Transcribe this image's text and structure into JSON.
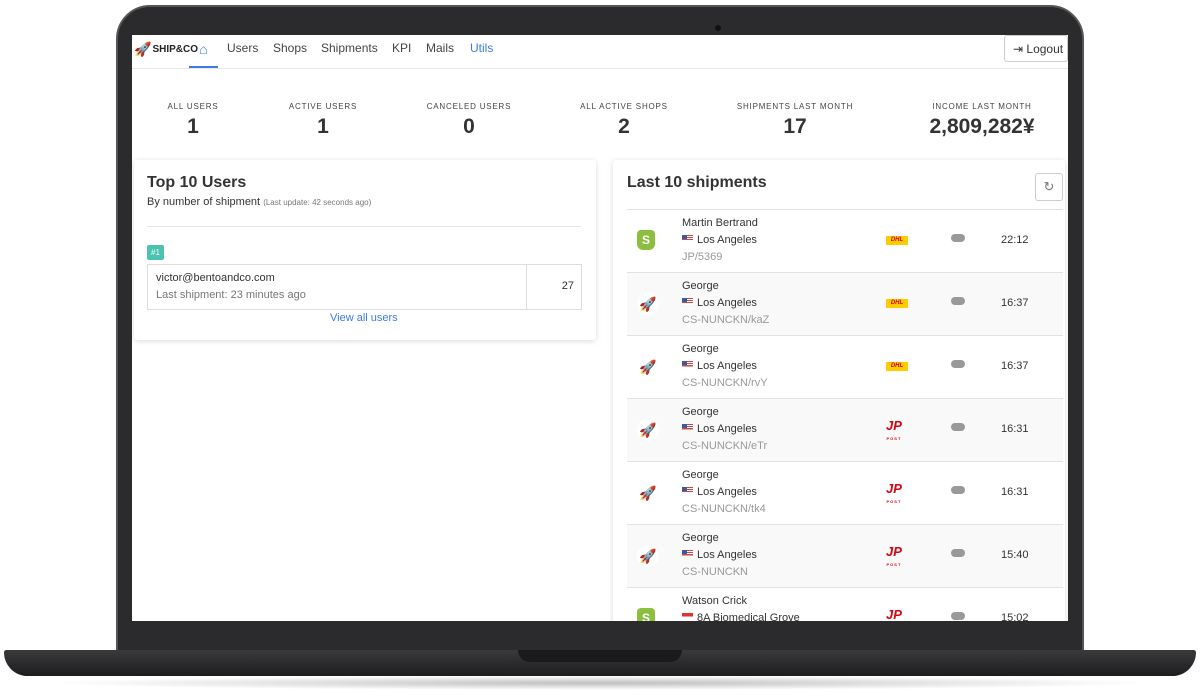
{
  "nav": {
    "logo": "SHIP&CO",
    "items": [
      "Users",
      "Shops",
      "Shipments",
      "KPI",
      "Mails",
      "Utils"
    ],
    "logout": "Logout",
    "active_color": "#3d7be0"
  },
  "stats": [
    {
      "label": "ALL USERS",
      "value": "1"
    },
    {
      "label": "ACTIVE USERS",
      "value": "1"
    },
    {
      "label": "CANCELED USERS",
      "value": "0"
    },
    {
      "label": "ALL ACTIVE SHOPS",
      "value": "2"
    },
    {
      "label": "SHIPMENTS LAST MONTH",
      "value": "17"
    },
    {
      "label": "INCOME LAST MONTH",
      "value": "2,809,282¥"
    }
  ],
  "top_users": {
    "title": "Top 10 Users",
    "subtitle": "By number of shipment",
    "update": "(Last update: 42 seconds ago)",
    "rank": "#1",
    "email": "victor@bentoandco.com",
    "last": "Last shipment: 23 minutes ago",
    "count": "27",
    "view_all": "View all users"
  },
  "shipments": {
    "title": "Last 10 shipments",
    "rows": [
      {
        "source": "shopify",
        "name": "Martin Bertrand",
        "flag": "us",
        "city": "Los Angeles",
        "ref": "JP/5369",
        "carrier": "DHL",
        "time": "22:12"
      },
      {
        "source": "shipandco",
        "name": "George",
        "flag": "us",
        "city": "Los Angeles",
        "ref": "CS-NUNCKN/kaZ",
        "carrier": "DHL",
        "time": "16:37"
      },
      {
        "source": "shipandco",
        "name": "George",
        "flag": "us",
        "city": "Los Angeles",
        "ref": "CS-NUNCKN/rvY",
        "carrier": "DHL",
        "time": "16:37"
      },
      {
        "source": "shipandco",
        "name": "George",
        "flag": "us",
        "city": "Los Angeles",
        "ref": "CS-NUNCKN/eTr",
        "carrier": "JP POST",
        "time": "16:31"
      },
      {
        "source": "shipandco",
        "name": "George",
        "flag": "us",
        "city": "Los Angeles",
        "ref": "CS-NUNCKN/tk4",
        "carrier": "JP POST",
        "time": "16:31"
      },
      {
        "source": "shipandco",
        "name": "George",
        "flag": "us",
        "city": "Los Angeles",
        "ref": "CS-NUNCKN",
        "carrier": "JP POST",
        "time": "15:40"
      },
      {
        "source": "shopify",
        "name": "Watson Crick",
        "flag": "sg",
        "city": "8A Biomedical Grove",
        "ref": "",
        "carrier": "JP POST",
        "time": "15:02"
      }
    ]
  }
}
